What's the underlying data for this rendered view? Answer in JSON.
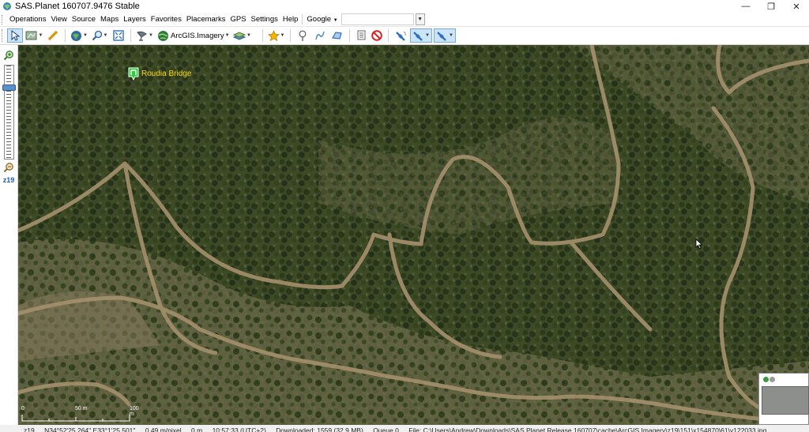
{
  "window": {
    "title": "SAS.Planet 160707.9476 Stable",
    "minimize": "—",
    "maximize": "❐",
    "close": "✕"
  },
  "menu": {
    "items": [
      "Operations",
      "View",
      "Source",
      "Maps",
      "Layers",
      "Favorites",
      "Placemarks",
      "GPS",
      "Settings",
      "Help"
    ],
    "search_provider": "Google",
    "search_value": ""
  },
  "toolbar": {
    "map_source_label": "ArcGIS.Imagery"
  },
  "zoom": {
    "level": "z19",
    "slider_fraction": 0.22
  },
  "map": {
    "placemark_label": "Roudia Bridge",
    "scale": {
      "zero": "0",
      "mid": "50 m",
      "end": "100 m"
    }
  },
  "status": {
    "zoom": "z19",
    "coords": "N34°52'25.264\" E33°1'25.501\"",
    "resolution": "0.49 m/pixel",
    "elevation": "0 m",
    "time": "10:57:33 (UTC+2)",
    "downloaded": "Downloaded: 1559 (32.9 MB)",
    "queue": "Queue 0",
    "file": "File: C:\\Users\\Andrew\\Downloads\\SAS.Planet.Release.160707\\cache\\ArcGIS.Imagery\\z19\\151\\x154870\\61\\y122033.jpg"
  },
  "colors": {
    "placemark_label": "#f3d11a",
    "zoom_level_text": "#1b5fb5",
    "toolbar_active": "#cce4f7"
  }
}
